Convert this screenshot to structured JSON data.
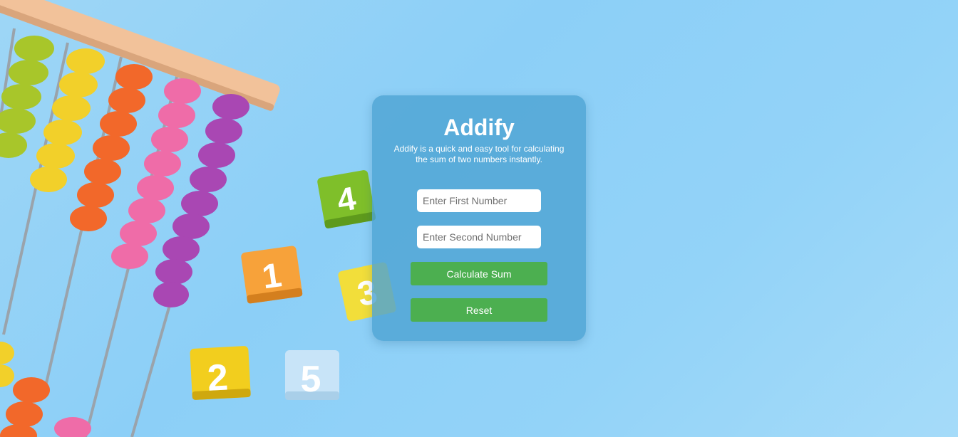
{
  "app": {
    "title": "Addify",
    "description": "Addify is a quick and easy tool for calculating the sum of two numbers instantly."
  },
  "form": {
    "first_placeholder": "Enter First Number",
    "second_placeholder": "Enter Second Number",
    "first_value": "",
    "second_value": "",
    "calculate_label": "Calculate Sum",
    "reset_label": "Reset"
  },
  "background": {
    "blocks": [
      "4",
      "1",
      "3",
      "2",
      "5"
    ]
  },
  "colors": {
    "background": "#8ccff7",
    "card": "#4ea4d3",
    "button": "#4caf50"
  }
}
